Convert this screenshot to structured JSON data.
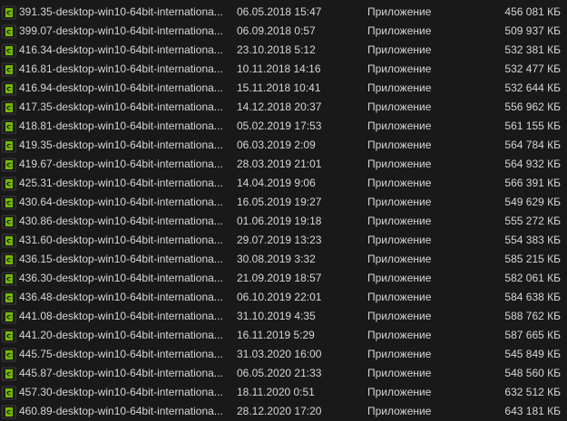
{
  "files": [
    {
      "name": "391.35-desktop-win10-64bit-internationa...",
      "modified": "06.05.2018 15:47",
      "type": "Приложение",
      "size": "456 081 КБ",
      "icon": "nvidia-installer-icon"
    },
    {
      "name": "399.07-desktop-win10-64bit-internationa...",
      "modified": "06.09.2018 0:57",
      "type": "Приложение",
      "size": "509 937 КБ",
      "icon": "nvidia-installer-icon"
    },
    {
      "name": "416.34-desktop-win10-64bit-internationa...",
      "modified": "23.10.2018 5:12",
      "type": "Приложение",
      "size": "532 381 КБ",
      "icon": "nvidia-installer-icon"
    },
    {
      "name": "416.81-desktop-win10-64bit-internationa...",
      "modified": "10.11.2018 14:16",
      "type": "Приложение",
      "size": "532 477 КБ",
      "icon": "nvidia-installer-icon"
    },
    {
      "name": "416.94-desktop-win10-64bit-internationa...",
      "modified": "15.11.2018 10:41",
      "type": "Приложение",
      "size": "532 644 КБ",
      "icon": "nvidia-installer-icon"
    },
    {
      "name": "417.35-desktop-win10-64bit-internationa...",
      "modified": "14.12.2018 20:37",
      "type": "Приложение",
      "size": "556 962 КБ",
      "icon": "nvidia-installer-icon"
    },
    {
      "name": "418.81-desktop-win10-64bit-internationa...",
      "modified": "05.02.2019 17:53",
      "type": "Приложение",
      "size": "561 155 КБ",
      "icon": "nvidia-installer-icon"
    },
    {
      "name": "419.35-desktop-win10-64bit-internationa...",
      "modified": "06.03.2019 2:09",
      "type": "Приложение",
      "size": "564 784 КБ",
      "icon": "nvidia-installer-icon"
    },
    {
      "name": "419.67-desktop-win10-64bit-internationa...",
      "modified": "28.03.2019 21:01",
      "type": "Приложение",
      "size": "564 932 КБ",
      "icon": "nvidia-installer-icon"
    },
    {
      "name": "425.31-desktop-win10-64bit-internationa...",
      "modified": "14.04.2019 9:06",
      "type": "Приложение",
      "size": "566 391 КБ",
      "icon": "nvidia-installer-icon"
    },
    {
      "name": "430.64-desktop-win10-64bit-internationa...",
      "modified": "16.05.2019 19:27",
      "type": "Приложение",
      "size": "549 629 КБ",
      "icon": "nvidia-installer-icon"
    },
    {
      "name": "430.86-desktop-win10-64bit-internationa...",
      "modified": "01.06.2019 19:18",
      "type": "Приложение",
      "size": "555 272 КБ",
      "icon": "nvidia-installer-icon"
    },
    {
      "name": "431.60-desktop-win10-64bit-internationa...",
      "modified": "29.07.2019 13:23",
      "type": "Приложение",
      "size": "554 383 КБ",
      "icon": "nvidia-installer-icon"
    },
    {
      "name": "436.15-desktop-win10-64bit-internationa...",
      "modified": "30.08.2019 3:32",
      "type": "Приложение",
      "size": "585 215 КБ",
      "icon": "nvidia-installer-icon"
    },
    {
      "name": "436.30-desktop-win10-64bit-internationa...",
      "modified": "21.09.2019 18:57",
      "type": "Приложение",
      "size": "582 061 КБ",
      "icon": "nvidia-installer-icon"
    },
    {
      "name": "436.48-desktop-win10-64bit-internationa...",
      "modified": "06.10.2019 22:01",
      "type": "Приложение",
      "size": "584 638 КБ",
      "icon": "nvidia-installer-icon"
    },
    {
      "name": "441.08-desktop-win10-64bit-internationa...",
      "modified": "31.10.2019 4:35",
      "type": "Приложение",
      "size": "588 762 КБ",
      "icon": "nvidia-installer-icon"
    },
    {
      "name": "441.20-desktop-win10-64bit-internationa...",
      "modified": "16.11.2019 5:29",
      "type": "Приложение",
      "size": "587 665 КБ",
      "icon": "nvidia-installer-icon"
    },
    {
      "name": "445.75-desktop-win10-64bit-internationa...",
      "modified": "31.03.2020 16:00",
      "type": "Приложение",
      "size": "545 849 КБ",
      "icon": "nvidia-installer-icon"
    },
    {
      "name": "445.87-desktop-win10-64bit-internationa...",
      "modified": "06.05.2020 21:33",
      "type": "Приложение",
      "size": "548 560 КБ",
      "icon": "nvidia-installer-icon"
    },
    {
      "name": "457.30-desktop-win10-64bit-internationa...",
      "modified": "18.11.2020 0:51",
      "type": "Приложение",
      "size": "632 512 КБ",
      "icon": "nvidia-installer-icon"
    },
    {
      "name": "460.89-desktop-win10-64bit-internationa...",
      "modified": "28.12.2020 17:20",
      "type": "Приложение",
      "size": "643 181 КБ",
      "icon": "nvidia-installer-icon"
    }
  ],
  "colors": {
    "background": "#191919",
    "text": "#d6d6d6",
    "icon_green": "#76b900"
  }
}
